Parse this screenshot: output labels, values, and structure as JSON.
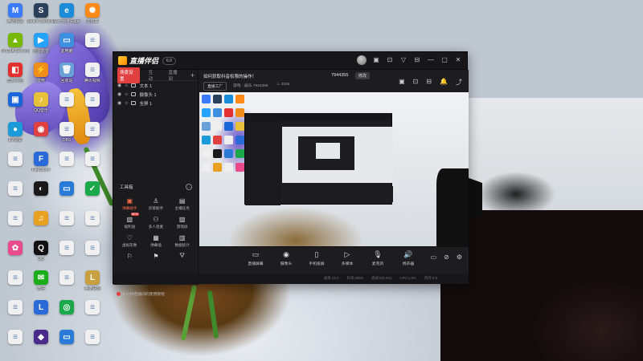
{
  "desktop": {
    "icons": [
      {
        "label": "腾讯会议",
        "color": "#3a7bff",
        "glyph": "M"
      },
      {
        "label": "Steam Corebluer",
        "color": "#2a3f5a",
        "glyph": "S"
      },
      {
        "label": "Microsoft Edge",
        "color": "#1a8cd8",
        "glyph": "e"
      },
      {
        "label": "向日葵",
        "color": "#ff8a1a",
        "glyph": "✺"
      },
      {
        "label": "NVIDIA GeForce",
        "color": "#76b900",
        "glyph": "▲"
      },
      {
        "label": "迅雷影音",
        "color": "#26a3ff",
        "glyph": "▶"
      },
      {
        "label": "此电脑",
        "color": "#3f8fe0",
        "glyph": "▭"
      },
      {
        "label": "",
        "color": "#f3f3f3",
        "glyph": "≡"
      },
      {
        "label": "剪映专业",
        "color": "#e23030",
        "glyph": "◧"
      },
      {
        "label": "雷电",
        "color": "#f08c1a",
        "glyph": "⚡"
      },
      {
        "label": "回收站",
        "color": "#6aa0d8",
        "glyph": "🗑"
      },
      {
        "label": "腾讯视频",
        "color": "#f0f0f0",
        "glyph": "≡"
      },
      {
        "label": "",
        "color": "#1a66d8",
        "glyph": "▣"
      },
      {
        "label": "QQ音乐",
        "color": "#e8c13a",
        "glyph": "♪"
      },
      {
        "label": "",
        "color": "#f0f0f0",
        "glyph": "≡"
      },
      {
        "label": "",
        "color": "#f0f0f0",
        "glyph": "≡"
      },
      {
        "label": "EV录屏",
        "color": "#1a9ad8",
        "glyph": "●"
      },
      {
        "label": "",
        "color": "#e04040",
        "glyph": "◉"
      },
      {
        "label": "OBS",
        "color": "#f0f0f0",
        "glyph": "≡"
      },
      {
        "label": "",
        "color": "#f0f0f0",
        "glyph": "≡"
      },
      {
        "label": "",
        "color": "#f0f0f0",
        "glyph": "≡"
      },
      {
        "label": "FastStone",
        "color": "#2a6ad8",
        "glyph": "F"
      },
      {
        "label": "",
        "color": "#f0f0f0",
        "glyph": "≡"
      },
      {
        "label": "",
        "color": "#f0f0f0",
        "glyph": "≡"
      },
      {
        "label": "",
        "color": "#f0f0f0",
        "glyph": "≡"
      },
      {
        "label": "",
        "color": "#1a1a1a",
        "glyph": "◐"
      },
      {
        "label": "",
        "color": "#2a7ad8",
        "glyph": "▭"
      },
      {
        "label": "",
        "color": "#1aa84a",
        "glyph": "✓"
      },
      {
        "label": "",
        "color": "#f0f0f0",
        "glyph": "≡"
      },
      {
        "label": "",
        "color": "#e8a020",
        "glyph": "♫"
      },
      {
        "label": "",
        "color": "#f0f0f0",
        "glyph": "≡"
      },
      {
        "label": "",
        "color": "#f0f0f0",
        "glyph": "≡"
      },
      {
        "label": "",
        "color": "#e84a8a",
        "glyph": "✿"
      },
      {
        "label": "QQ",
        "color": "#111111",
        "glyph": "Q"
      },
      {
        "label": "",
        "color": "#f0f0f0",
        "glyph": "≡"
      },
      {
        "label": "",
        "color": "#f0f0f0",
        "glyph": "≡"
      },
      {
        "label": "",
        "color": "#f0f0f0",
        "glyph": "≡"
      },
      {
        "label": "微信",
        "color": "#1aad19",
        "glyph": "✉"
      },
      {
        "label": "",
        "color": "#f0f0f0",
        "glyph": "≡"
      },
      {
        "label": "英雄联盟",
        "color": "#c8a040",
        "glyph": "L"
      },
      {
        "label": "",
        "color": "#f0f0f0",
        "glyph": "≡"
      },
      {
        "label": "",
        "color": "#2a6ad8",
        "glyph": "L"
      },
      {
        "label": "",
        "color": "#1aa84a",
        "glyph": "◎"
      },
      {
        "label": "",
        "color": "#f0f0f0",
        "glyph": "≡"
      },
      {
        "label": "",
        "color": "#f0f0f0",
        "glyph": "≡"
      },
      {
        "label": "",
        "color": "#4a2a8a",
        "glyph": "◆"
      },
      {
        "label": "",
        "color": "#2a7ad8",
        "glyph": "▭"
      },
      {
        "label": "",
        "color": "#f0f0f0",
        "glyph": "≡"
      }
    ]
  },
  "app": {
    "logo_text": "直播伴侣",
    "version": "6.0",
    "title_controls": [
      "▣",
      "⊡",
      "▽",
      "⊟",
      "—",
      "▢",
      "✕"
    ],
    "scene_tabs": [
      "场景设置",
      "互动",
      "直播间"
    ],
    "scene_add": "+",
    "sources": [
      {
        "name": "文本 1"
      },
      {
        "name": "摄像头 1"
      },
      {
        "name": "全屏 1"
      }
    ],
    "toolbox": {
      "title": "工具箱",
      "more": "…",
      "items": [
        {
          "label": "弹幕助手",
          "icon": "▣",
          "hot": true,
          "badge": ""
        },
        {
          "label": "房管助手",
          "icon": "♙",
          "hot": false,
          "badge": ""
        },
        {
          "label": "主播任务",
          "icon": "▤",
          "hot": false,
          "badge": ""
        },
        {
          "label": "福利送",
          "icon": "▧",
          "hot": false,
          "badge": "NEW"
        },
        {
          "label": "多人连麦",
          "icon": "⚇",
          "hot": false,
          "badge": ""
        },
        {
          "label": "游戏屏",
          "icon": "▨",
          "hot": false,
          "badge": ""
        },
        {
          "label": "虚拟形象",
          "icon": "♡",
          "hot": false,
          "badge": ""
        },
        {
          "label": "弹幕墙",
          "icon": "▦",
          "hot": false,
          "badge": ""
        },
        {
          "label": "数据统计",
          "icon": "▥",
          "hot": false,
          "badge": ""
        },
        {
          "label": "",
          "icon": "⚐",
          "hot": false,
          "badge": ""
        },
        {
          "label": "",
          "icon": "⚑",
          "hot": false,
          "badge": ""
        },
        {
          "label": "",
          "icon": "⛛",
          "hot": false,
          "badge": ""
        }
      ]
    },
    "help_link": "5 分钟直播间的使用教程",
    "stream": {
      "title": "如何获取抖音权限的操作！",
      "room_id": "7944355",
      "edit_label": "修改",
      "category": "直播工厂",
      "meta": "游戏 · 娱乐",
      "meta_id": "7944355",
      "viewers": "2026"
    },
    "header_tools": [
      "▣",
      "⊡",
      "⊟",
      "🔔",
      "⤴"
    ],
    "actions": [
      {
        "label": "直播屏幕",
        "icon": "▭",
        "red": false
      },
      {
        "label": "摄像头",
        "icon": "◉",
        "red": false
      },
      {
        "label": "手机投屏",
        "icon": "▯",
        "red": false
      },
      {
        "label": "多媒体",
        "icon": "▷",
        "red": false
      },
      {
        "label": "麦克风",
        "icon": "🎙",
        "red": false
      },
      {
        "label": "扬声器",
        "icon": "🔊",
        "red": true
      }
    ],
    "right_tools": [
      "▭",
      "⊘",
      "⚙"
    ],
    "status": [
      "帧率:25.0",
      "码率:0kb/s",
      "丢帧:0(0.0%)",
      "CPU:1.0%",
      "内存:3.5"
    ]
  },
  "colors": {
    "accent": "#e04040",
    "window_bg": "#1d1d20",
    "titlebar_bg": "#17171a"
  }
}
